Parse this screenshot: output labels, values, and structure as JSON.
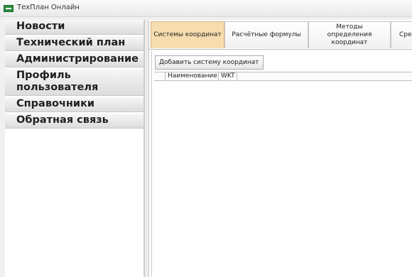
{
  "window": {
    "title": "ТехПлан Онлайн",
    "icon": "app-logo-icon",
    "icon_color": "#2b8a3e"
  },
  "sidebar": {
    "items": [
      {
        "label": "Новости"
      },
      {
        "label": "Технический план"
      },
      {
        "label": "Администрирование"
      },
      {
        "label": "Профиль пользователя"
      },
      {
        "label": "Справочники"
      },
      {
        "label": "Обратная связь"
      }
    ]
  },
  "tabs": [
    {
      "label": "Системы координат",
      "active": true
    },
    {
      "label": "Расчётные формулы",
      "active": false
    },
    {
      "label": "Методы\nопределения\nкоординат",
      "active": false
    },
    {
      "label": "Сре",
      "active": false
    }
  ],
  "toolbar": {
    "add_label": "Добавить систему координат"
  },
  "grid": {
    "columns": [
      "",
      "Наименование",
      "WKT"
    ]
  },
  "colors": {
    "active_tab": "#f6dcae",
    "sidebar_bg": "#ffffff",
    "window_bg": "#f0f0f0"
  }
}
